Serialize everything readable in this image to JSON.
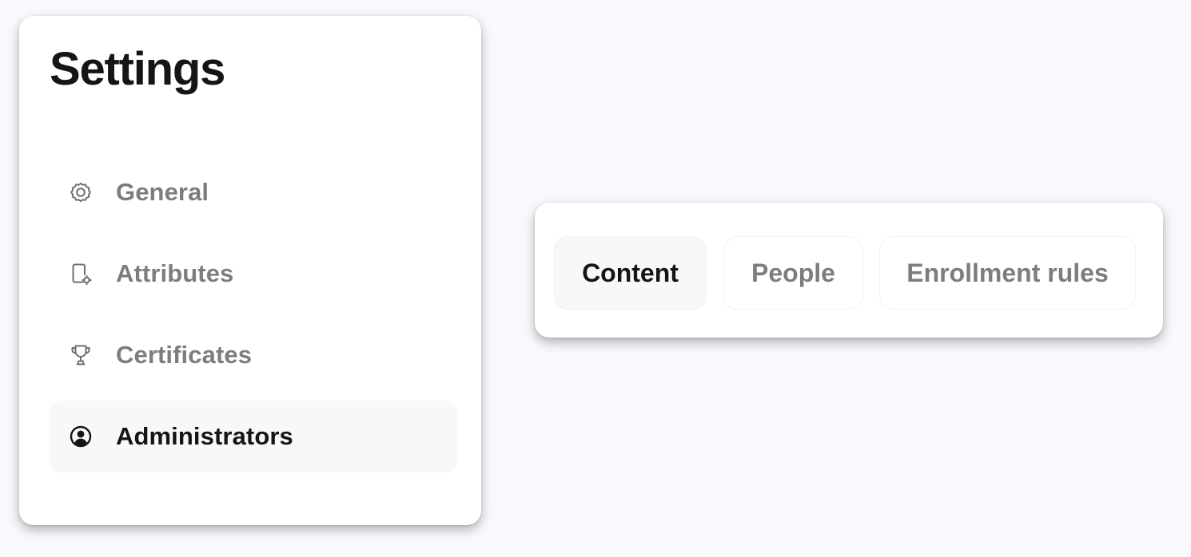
{
  "settings": {
    "title": "Settings",
    "nav_items": [
      {
        "label": "General",
        "icon": "gear-icon",
        "active": false
      },
      {
        "label": "Attributes",
        "icon": "document-gear-icon",
        "active": false
      },
      {
        "label": "Certificates",
        "icon": "trophy-icon",
        "active": false
      },
      {
        "label": "Administrators",
        "icon": "user-circle-icon",
        "active": true
      }
    ]
  },
  "tabs": {
    "items": [
      {
        "label": "Content",
        "active": true
      },
      {
        "label": "People",
        "active": false
      },
      {
        "label": "Enrollment rules",
        "active": false
      }
    ]
  },
  "colors": {
    "background": "#f9f8fc",
    "panel": "#ffffff",
    "active_text": "#151515",
    "inactive_text": "#7d7d7f",
    "active_fill": "#f8f7fa"
  }
}
